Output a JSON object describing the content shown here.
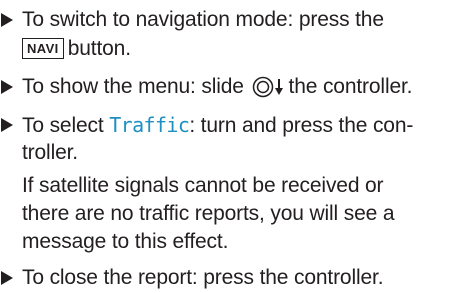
{
  "step1": {
    "line1": "To switch to navigation mode: press the",
    "key_label": "NAVI",
    "line2_suffix": "button."
  },
  "step2": {
    "prefix": "To show the menu: slide",
    "controller_icon": "controller-slide-down-icon",
    "suffix": "the controller."
  },
  "step3": {
    "prefix": "To select",
    "display_term": "Traffic",
    "suffix": ": turn and press the con-",
    "line2": "troller."
  },
  "note": {
    "line1": "If satellite signals cannot be received or",
    "line2": "there are no traffic reports, you will see a",
    "line3": "message to this effect."
  },
  "step4": {
    "text": "To close the report: press the controller."
  },
  "colors": {
    "text": "#231f20",
    "display_term": "#1e8fc2"
  },
  "bullet_icon": "triangle-bullet-icon"
}
